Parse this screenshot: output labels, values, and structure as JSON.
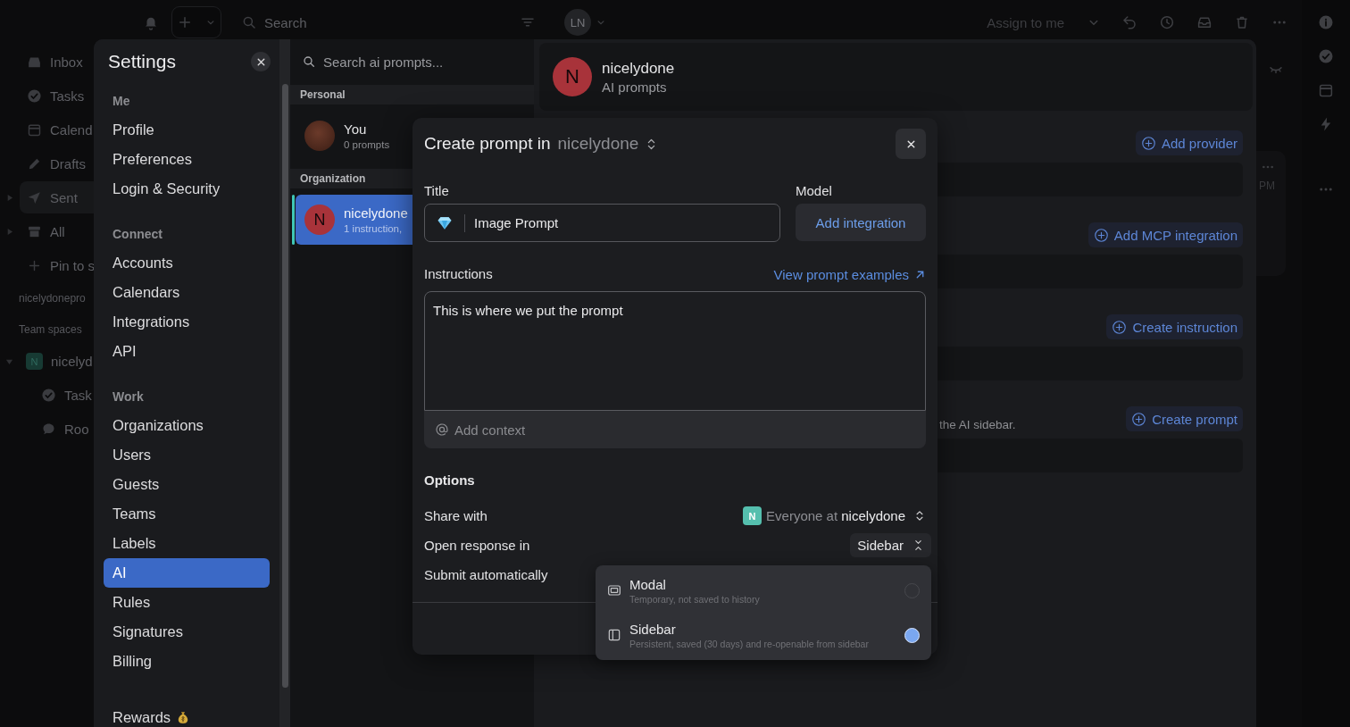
{
  "app": {
    "topbar": {
      "search": {
        "placeholder": "Search"
      },
      "avatar": "LN",
      "assign": "Assign to me"
    },
    "sidebar": {
      "items": [
        {
          "label": "Inbox",
          "selected": false
        },
        {
          "label": "Tasks",
          "selected": false
        },
        {
          "label": "Calend",
          "selected": false
        },
        {
          "label": "Drafts",
          "selected": false
        },
        {
          "label": "Sent",
          "selected": true,
          "expanded": false
        },
        {
          "label": "All",
          "selected": false,
          "expanded": false
        },
        {
          "label": "Pin to s",
          "selected": false
        }
      ],
      "workspace": "nicelydonepro",
      "team_heading": "Team spaces",
      "team": {
        "badge": "N",
        "name": "nicelyd",
        "expanded": true,
        "children": [
          {
            "label": "Task"
          },
          {
            "label": "Roo"
          }
        ]
      }
    },
    "card": {
      "time": "PM"
    }
  },
  "settings": {
    "title": "Settings",
    "nav": {
      "groups": [
        {
          "title": "Me",
          "items": [
            {
              "label": "Profile",
              "selected": false
            },
            {
              "label": "Preferences",
              "selected": false
            },
            {
              "label": "Login & Security",
              "selected": false
            }
          ]
        },
        {
          "title": "Connect",
          "items": [
            {
              "label": "Accounts",
              "selected": false
            },
            {
              "label": "Calendars",
              "selected": false
            },
            {
              "label": "Integrations",
              "selected": false
            },
            {
              "label": "API",
              "selected": false
            }
          ]
        },
        {
          "title": "Work",
          "items": [
            {
              "label": "Organizations",
              "selected": false
            },
            {
              "label": "Users",
              "selected": false
            },
            {
              "label": "Guests",
              "selected": false
            },
            {
              "label": "Teams",
              "selected": false
            },
            {
              "label": "Labels",
              "selected": false
            },
            {
              "label": "AI",
              "selected": true
            },
            {
              "label": "Rules",
              "selected": false
            },
            {
              "label": "Signatures",
              "selected": false
            },
            {
              "label": "Billing",
              "selected": false
            }
          ]
        }
      ],
      "footer_item": {
        "label": "Rewards",
        "selected": false
      }
    },
    "prompt_list": {
      "search": {
        "placeholder": "Search ai prompts..."
      },
      "sections": [
        {
          "title": "Personal",
          "items": [
            {
              "name": "You",
              "subtitle": "0 prompts",
              "selected": false,
              "avatar": {
                "kind": "photo"
              }
            }
          ]
        },
        {
          "title": "Organization",
          "items": [
            {
              "name": "nicelydone",
              "subtitle": "1 instruction,",
              "selected": true,
              "avatar": {
                "kind": "letter",
                "letter": "N"
              }
            }
          ]
        }
      ]
    },
    "detail": {
      "header": {
        "avatar": "N",
        "title": "nicelydone",
        "subtitle": "AI prompts"
      },
      "sections": [
        {
          "action": "Add provider"
        },
        {
          "action": "Add MCP integration"
        },
        {
          "action": "Create instruction"
        },
        {
          "description": "the AI sidebar.",
          "action": "Create prompt"
        }
      ]
    }
  },
  "prompt_modal": {
    "title": "Create prompt in",
    "organization": "nicelydone",
    "title_field": {
      "label": "Title",
      "value": "Image Prompt"
    },
    "model": {
      "label": "Model",
      "button": "Add integration"
    },
    "instructions": {
      "label": "Instructions",
      "link": "View prompt examples",
      "value": "This is where we put the prompt",
      "add_context": "Add context"
    },
    "options": {
      "heading": "Options",
      "rows": [
        {
          "kind": "share",
          "label": "Share with",
          "badge": "N",
          "value": "Everyone at **nicelydone**"
        },
        {
          "kind": "select",
          "label": "Open response in",
          "value": "Sidebar",
          "expanded": true,
          "menu": [
            {
              "label": "Modal",
              "description": "Temporary, not saved to history",
              "selected": false
            },
            {
              "label": "Sidebar",
              "description": "Persistent, saved (30 days) and re-openable from sidebar",
              "selected": true
            }
          ]
        },
        {
          "kind": "plain",
          "label": "Submit automatically"
        }
      ]
    }
  }
}
